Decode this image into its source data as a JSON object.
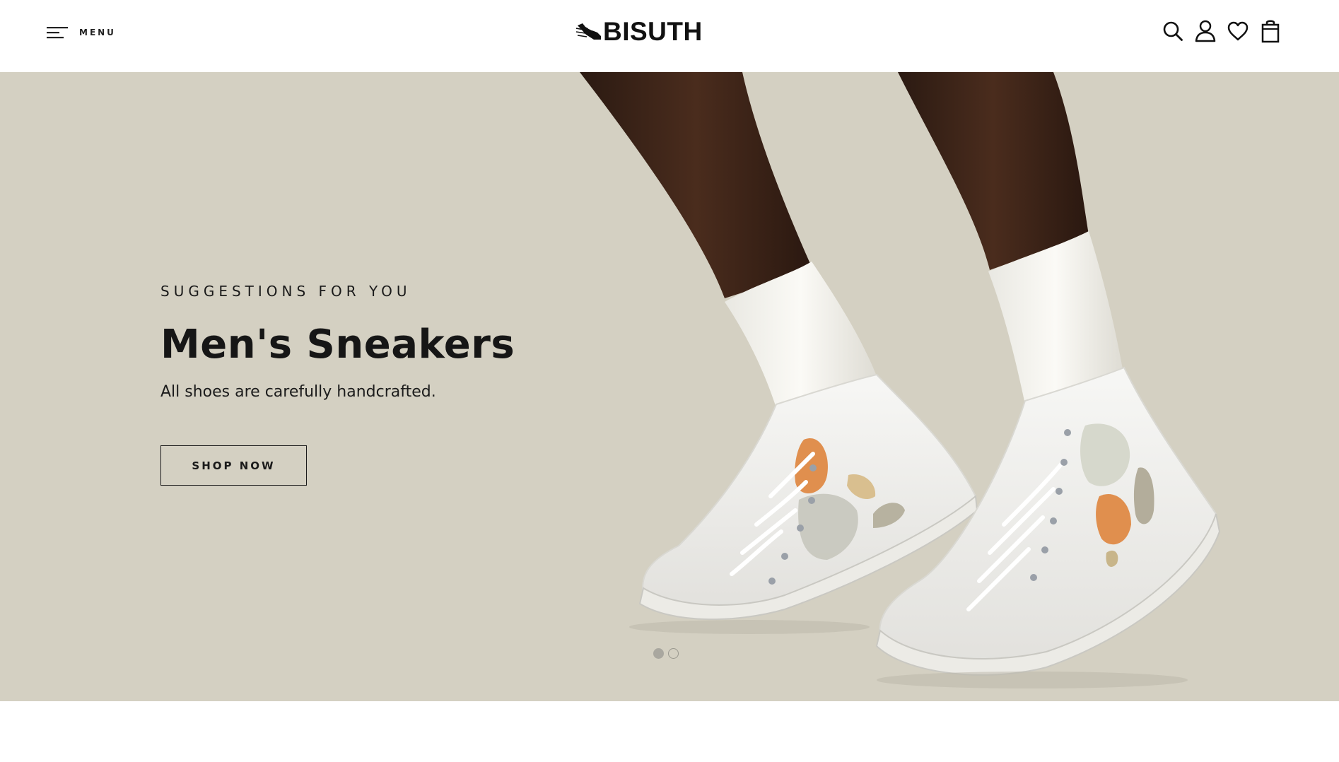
{
  "header": {
    "menu_label": "MENU",
    "logo_text": "BISUTH",
    "icons": [
      "search-icon",
      "account-icon",
      "wishlist-heart-icon",
      "shopping-bag-icon"
    ]
  },
  "hero": {
    "eyebrow": "SUGGESTIONS FOR YOU",
    "title": "Men's Sneakers",
    "subtitle": "All shoes are carefully handcrafted.",
    "cta_label": "SHOP NOW",
    "slides_total": 2,
    "active_slide": 1,
    "image": "hero-sneakers-image"
  },
  "colors": {
    "hero_background": "#d4d0c2",
    "header_background": "#ffffff",
    "text": "#111111",
    "dot_active": "#a9a79f"
  }
}
